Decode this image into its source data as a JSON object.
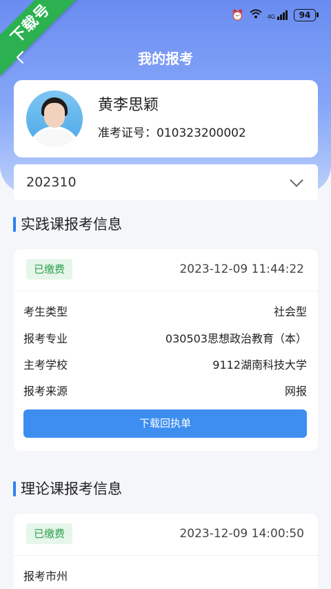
{
  "status_bar": {
    "battery": "94",
    "network": "4G",
    "icons": [
      "alarm-icon",
      "wifi-icon",
      "signal-icon",
      "battery-icon"
    ]
  },
  "ribbon": {
    "text": "下载号"
  },
  "header": {
    "title": "我的报考",
    "back_icon": "chevron-left-icon"
  },
  "profile": {
    "name": "黄李思颖",
    "exam_number": "准考证号：010323200002"
  },
  "session_select": {
    "value": "202310"
  },
  "practice_section": {
    "title": "实践课报考信息",
    "badge": "已缴费",
    "time": "2023-12-09 11:44:22",
    "rows": [
      {
        "label": "考生类型",
        "value": "社会型"
      },
      {
        "label": "报考专业",
        "value": "030503思想政治教育（本）"
      },
      {
        "label": "主考学校",
        "value": "9112湖南科技大学"
      },
      {
        "label": "报考来源",
        "value": "网报"
      }
    ],
    "button": "下载回执单"
  },
  "theory_section": {
    "title": "理论课报考信息",
    "badge": "已缴费",
    "time": "2023-12-09 14:00:50",
    "rows": [
      {
        "label": "报考市州",
        "value": ""
      }
    ]
  },
  "colors": {
    "header_gradient_top": "#6a8cf1",
    "accent_blue": "#3d8ef0",
    "badge_green_bg": "#e6f6ea",
    "badge_green_text": "#2e9e4f",
    "ribbon_green": "#2bb150"
  }
}
